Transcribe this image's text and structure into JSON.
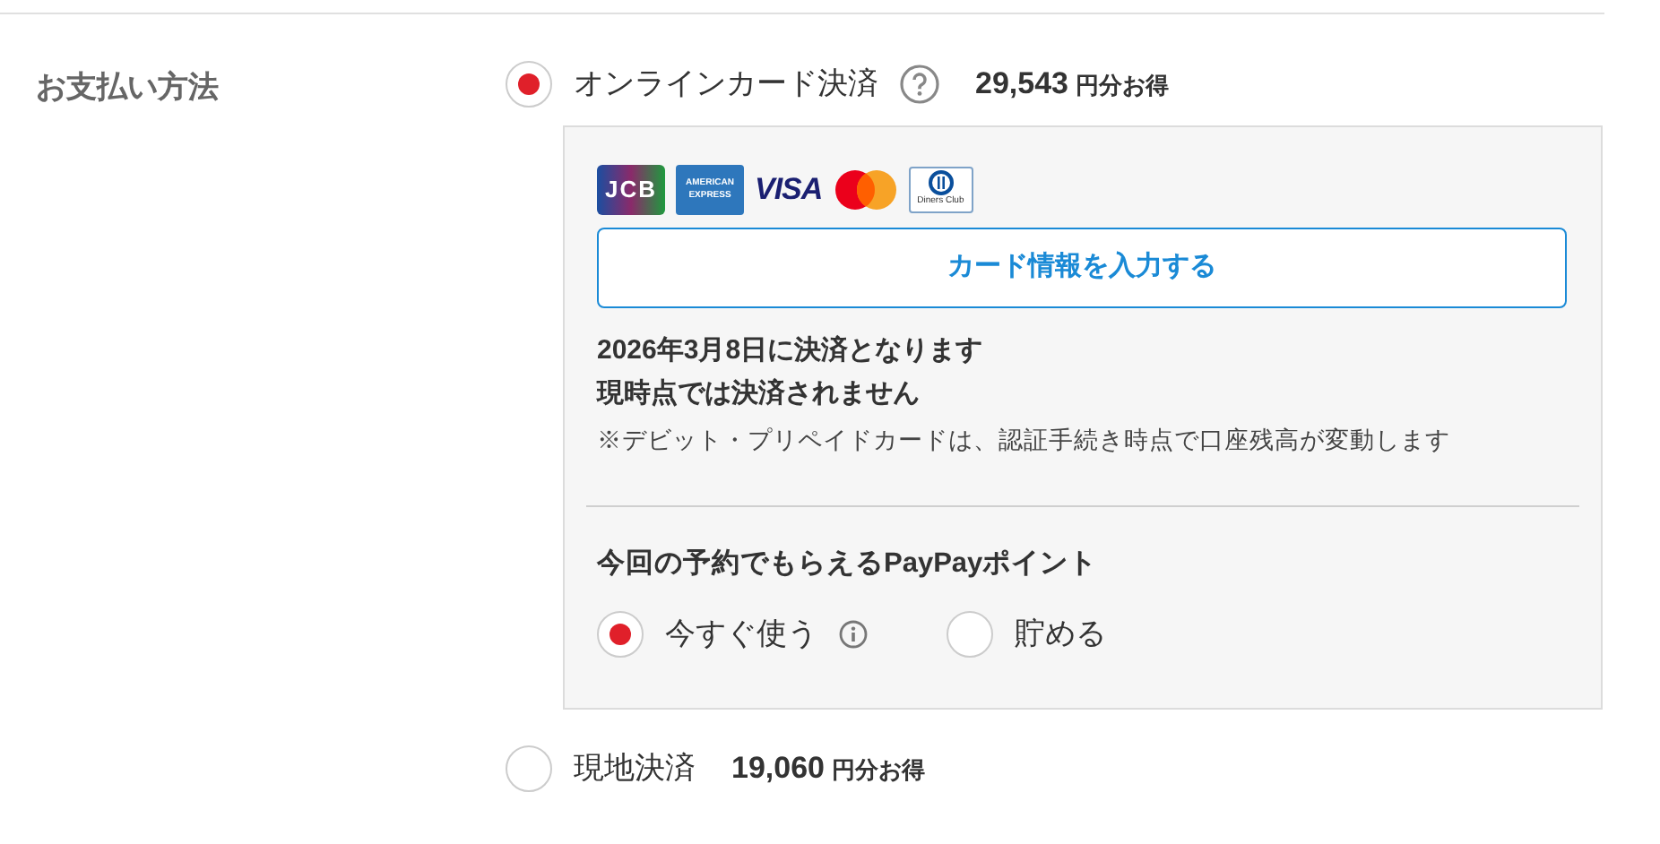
{
  "section_label": "お支払い方法",
  "payment_options": [
    {
      "kind": "online",
      "label": "オンラインカード決済",
      "help": true,
      "amount": "29,543",
      "amount_suffix": "円分お得",
      "selected": true,
      "card_brands": [
        {
          "kind": "jcb",
          "label": "JCB"
        },
        {
          "kind": "amex",
          "label": "AMERICAN EXPRESS"
        },
        {
          "kind": "visa",
          "label": "VISA"
        },
        {
          "kind": "mastercard"
        },
        {
          "kind": "diners",
          "label": "Diners Club"
        }
      ],
      "card_button": "カード情報を入力する",
      "notice_lines": [
        "2026年3月8日に決済となります",
        "現時点では決済されません"
      ],
      "note": "※デビット・プリペイドカードは、認証手続き時点で口座残高が変動します",
      "points_title": "今回の予約でもらえるPayPayポイント",
      "points_options": [
        {
          "label": "今すぐ使う",
          "info": true,
          "selected": true
        },
        {
          "label": "貯める",
          "info": false,
          "selected": false
        }
      ]
    },
    {
      "kind": "onsite",
      "label": "現地決済",
      "help": false,
      "amount": "19,060",
      "amount_suffix": "円分お得",
      "selected": false
    }
  ]
}
